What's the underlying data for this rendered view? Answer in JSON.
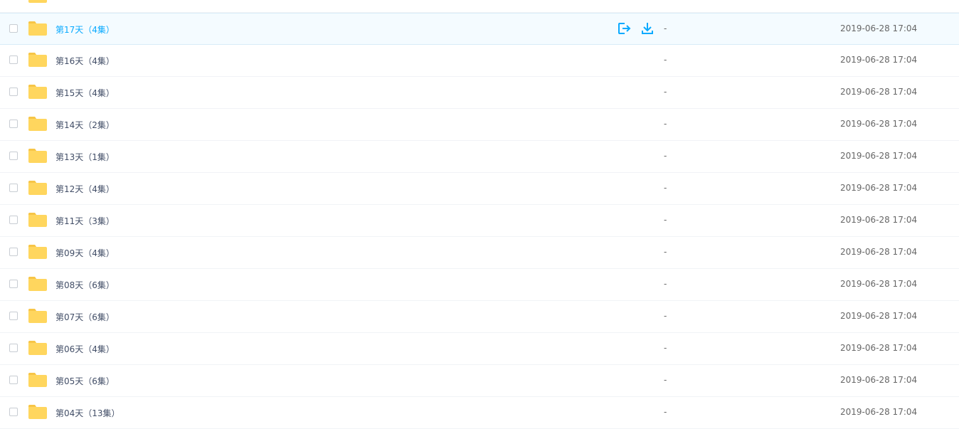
{
  "colors": {
    "folder": "#ffd65e",
    "folder_tab": "#f7c547",
    "accent": "#09aaff",
    "text": "#424e67",
    "meta_text": "#666666"
  },
  "actions": {
    "share_icon": "share-icon",
    "download_icon": "download-icon"
  },
  "files": [
    {
      "name": "第17天（4集）",
      "size": "-",
      "modified": "2019-06-28 17:04",
      "hovered": true
    },
    {
      "name": "第16天（4集）",
      "size": "-",
      "modified": "2019-06-28 17:04"
    },
    {
      "name": "第15天（4集）",
      "size": "-",
      "modified": "2019-06-28 17:04"
    },
    {
      "name": "第14天（2集）",
      "size": "-",
      "modified": "2019-06-28 17:04"
    },
    {
      "name": "第13天（1集）",
      "size": "-",
      "modified": "2019-06-28 17:04"
    },
    {
      "name": "第12天（4集）",
      "size": "-",
      "modified": "2019-06-28 17:04"
    },
    {
      "name": "第11天（3集）",
      "size": "-",
      "modified": "2019-06-28 17:04"
    },
    {
      "name": "第09天（4集）",
      "size": "-",
      "modified": "2019-06-28 17:04"
    },
    {
      "name": "第08天（6集）",
      "size": "-",
      "modified": "2019-06-28 17:04"
    },
    {
      "name": "第07天（6集）",
      "size": "-",
      "modified": "2019-06-28 17:04"
    },
    {
      "name": "第06天（4集）",
      "size": "-",
      "modified": "2019-06-28 17:04"
    },
    {
      "name": "第05天（6集）",
      "size": "-",
      "modified": "2019-06-28 17:04"
    },
    {
      "name": "第04天（13集）",
      "size": "-",
      "modified": "2019-06-28 17:04"
    }
  ]
}
